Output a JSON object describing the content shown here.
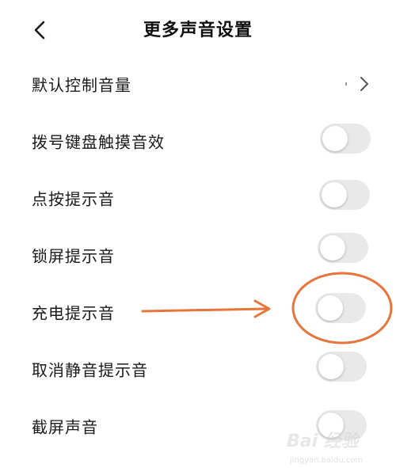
{
  "header": {
    "title": "更多声音设置",
    "back_icon": "chevron-left-icon"
  },
  "settings": {
    "items": [
      {
        "label": "默认控制音量",
        "type": "link",
        "icon": "chevron-right-icon"
      },
      {
        "label": "拨号键盘触摸音效",
        "type": "toggle",
        "checked": false
      },
      {
        "label": "点按提示音",
        "type": "toggle",
        "checked": false
      },
      {
        "label": "锁屏提示音",
        "type": "toggle",
        "checked": false
      },
      {
        "label": "充电提示音",
        "type": "toggle",
        "checked": false
      },
      {
        "label": "取消静音提示音",
        "type": "toggle",
        "checked": false
      },
      {
        "label": "截屏声音",
        "type": "toggle",
        "checked": false
      }
    ]
  },
  "annotation": {
    "color": "#e8743b",
    "target": "充电提示音"
  },
  "watermark": {
    "brand": "Bai 经验",
    "url": "jingyan.baidu.com"
  },
  "colors": {
    "toggle_off": "#e9e9e9",
    "knob": "#ffffff",
    "text": "#1a1a1a",
    "annotation": "#e8743b"
  }
}
